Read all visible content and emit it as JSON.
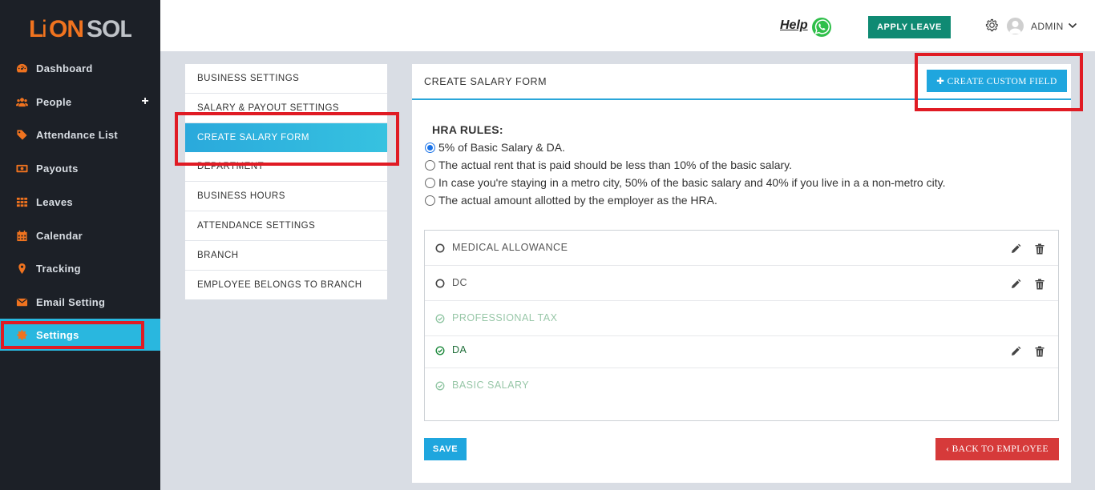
{
  "brand": {
    "logo_text": "LIONSOL",
    "accent": "#f0731f"
  },
  "sidebar": {
    "items": [
      {
        "label": "Dashboard",
        "icon": "dashboard-icon"
      },
      {
        "label": "People",
        "icon": "people-icon",
        "has_plus": true
      },
      {
        "label": "Attendance List",
        "icon": "tag-icon"
      },
      {
        "label": "Payouts",
        "icon": "money-icon"
      },
      {
        "label": "Leaves",
        "icon": "grid-icon"
      },
      {
        "label": "Calendar",
        "icon": "calendar-icon"
      },
      {
        "label": "Tracking",
        "icon": "map-pin-icon"
      },
      {
        "label": "Email Setting",
        "icon": "envelope-icon"
      },
      {
        "label": "Settings",
        "icon": "gear-icon",
        "active": true
      }
    ],
    "plus_symbol": "+"
  },
  "topbar": {
    "help_label": "Help",
    "apply_leave_label": "APPLY LEAVE",
    "user_label": "ADMIN"
  },
  "settings_menu": {
    "items": [
      "BUSINESS SETTINGS",
      "SALARY & PAYOUT SETTINGS",
      "CREATE SALARY FORM",
      "DEPARTMENT",
      "BUSINESS HOURS",
      "ATTENDANCE SETTINGS",
      "BRANCH",
      "EMPLOYEE BELONGS TO BRANCH"
    ],
    "active_index": 2
  },
  "panel": {
    "title": "CREATE SALARY FORM",
    "create_custom_field_label": "✚ CREATE CUSTOM FIELD",
    "hra_title": "HRA RULES:",
    "hra_options": [
      "5% of Basic Salary & DA.",
      "The actual rent that is paid should be less than 10% of the basic salary.",
      "In case you're staying in a metro city, 50% of the basic salary and 40% if you live in a a non-metro city.",
      "The actual amount allotted by the employer as the HRA."
    ],
    "hra_selected_index": 0,
    "fields": [
      {
        "label": "MEDICAL ALLOWANCE",
        "state": "circle",
        "editable": true
      },
      {
        "label": "DC",
        "state": "circle",
        "editable": true
      },
      {
        "label": "PROFESSIONAL TAX",
        "state": "check-faded",
        "editable": false
      },
      {
        "label": "DA",
        "state": "check",
        "editable": true
      },
      {
        "label": "BASIC SALARY",
        "state": "check-faded",
        "editable": false
      }
    ],
    "save_label": "SAVE",
    "back_label": "‹ BACK TO EMPLOYEE"
  }
}
